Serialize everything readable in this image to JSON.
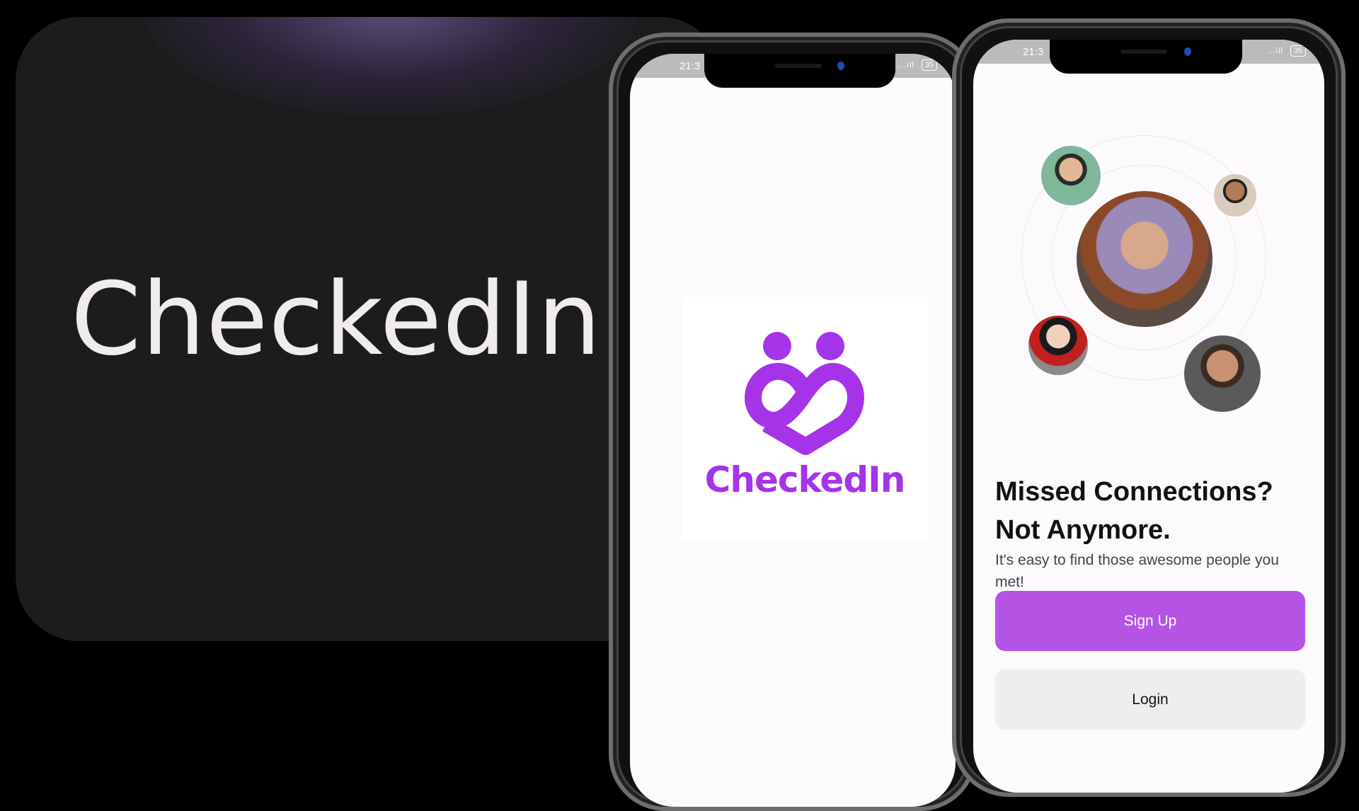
{
  "hero": {
    "title": "CheckedIn"
  },
  "status_bar": {
    "time": "21:3",
    "signal": "...ıll",
    "battery": "35"
  },
  "splash": {
    "logo_text": "CheckedIn"
  },
  "welcome": {
    "heading_line1": "Missed Connections?",
    "heading_line2": "Not Anymore.",
    "subtitle": "It's easy to find those awesome people you met!",
    "signup_label": "Sign Up",
    "login_label": "Login"
  },
  "colors": {
    "brand": "#a533e8",
    "button": "#b553e4",
    "background": "#1c1c1d"
  }
}
